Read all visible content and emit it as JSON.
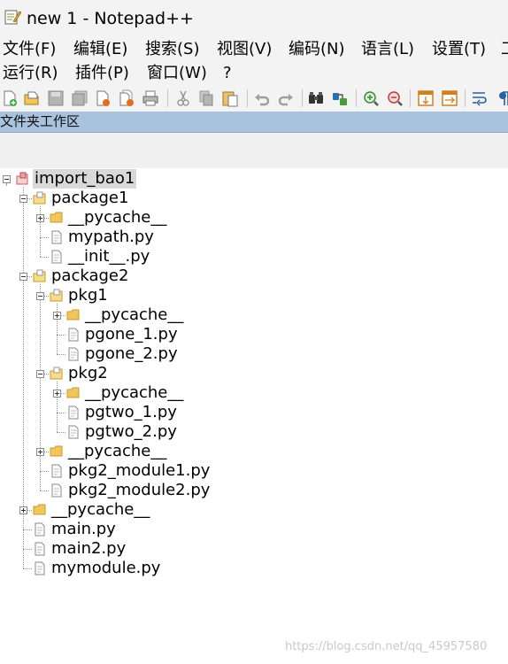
{
  "window": {
    "title": "new 1 - Notepad++"
  },
  "menu": {
    "row1": [
      "文件(F)",
      "编辑(E)",
      "搜索(S)",
      "视图(V)",
      "编码(N)",
      "语言(L)",
      "设置(T)",
      "工"
    ],
    "row2": [
      "运行(R)",
      "插件(P)",
      "窗口(W)",
      "?"
    ]
  },
  "toolbar": {
    "buttons": [
      "new-file-icon",
      "open-file-icon",
      "save-icon",
      "save-all-icon",
      "close-icon",
      "close-all-icon",
      "print-icon",
      "cut-icon",
      "copy-icon",
      "paste-icon",
      "undo-icon",
      "redo-icon",
      "find-icon",
      "replace-icon",
      "zoom-in-icon",
      "zoom-out-icon",
      "sync-vertical-icon",
      "sync-horizontal-icon",
      "word-wrap-icon",
      "show-all-chars-icon"
    ]
  },
  "panel": {
    "title": "文件夹工作区"
  },
  "tree": {
    "nodes": [
      {
        "label": "import_bao1",
        "type": "root",
        "expander": "minus",
        "selected": true
      },
      {
        "label": "package1",
        "type": "package",
        "expander": "minus"
      },
      {
        "label": "__pycache__",
        "type": "folder",
        "expander": "plus"
      },
      {
        "label": "mypath.py",
        "type": "file"
      },
      {
        "label": "__init__.py",
        "type": "file"
      },
      {
        "label": "package2",
        "type": "package",
        "expander": "minus"
      },
      {
        "label": "pkg1",
        "type": "package",
        "expander": "minus"
      },
      {
        "label": "__pycache__",
        "type": "folder",
        "expander": "plus"
      },
      {
        "label": "pgone_1.py",
        "type": "file"
      },
      {
        "label": "pgone_2.py",
        "type": "file"
      },
      {
        "label": "pkg2",
        "type": "package",
        "expander": "minus"
      },
      {
        "label": "__pycache__",
        "type": "folder",
        "expander": "plus"
      },
      {
        "label": "pgtwo_1.py",
        "type": "file"
      },
      {
        "label": "pgtwo_2.py",
        "type": "file"
      },
      {
        "label": "__pycache__",
        "type": "folder",
        "expander": "plus"
      },
      {
        "label": "pkg2_module1.py",
        "type": "file"
      },
      {
        "label": "pkg2_module2.py",
        "type": "file"
      },
      {
        "label": "__pycache__",
        "type": "folder",
        "expander": "plus"
      },
      {
        "label": "main.py",
        "type": "file"
      },
      {
        "label": "main2.py",
        "type": "file"
      },
      {
        "label": "mymodule.py",
        "type": "file"
      }
    ]
  },
  "watermark": "https://blog.csdn.net/qq_45957580",
  "colors": {
    "panel_header": "#a9c3df",
    "selection": "#d9d9d9",
    "folder": "#f2c65a",
    "root_folder": "#e8a0a0"
  }
}
